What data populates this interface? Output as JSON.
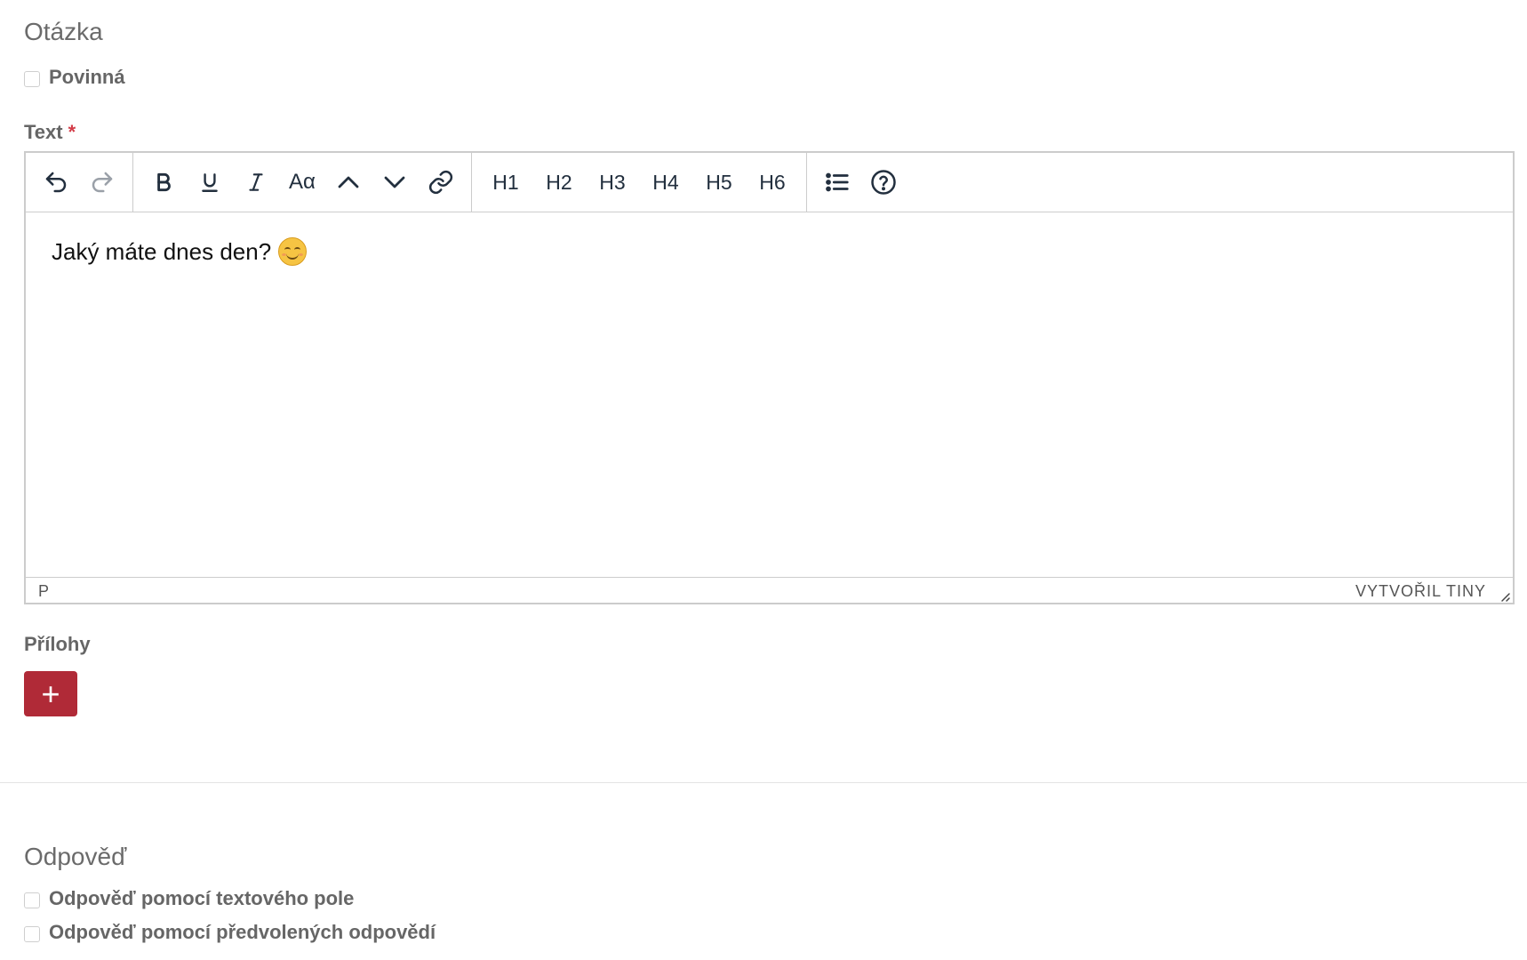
{
  "question": {
    "title": "Otázka",
    "required_label": "Povinná",
    "text_label": "Text",
    "required_marker": "*"
  },
  "editor": {
    "toolbar": {
      "undo": "undo-icon",
      "redo": "redo-icon",
      "bold": "bold-icon",
      "underline": "underline-icon",
      "italic": "italic-icon",
      "font_size_label": "Aα",
      "superscript": "chevron-up-icon",
      "subscript": "chevron-down-icon",
      "link": "link-icon",
      "headings": [
        "H1",
        "H2",
        "H3",
        "H4",
        "H5",
        "H6"
      ],
      "bullet_list": "bullet-list-icon",
      "help": "help-icon"
    },
    "content": "Jaký máte dnes den?",
    "emoji": "smiling-face-emoji",
    "status_path": "P",
    "status_brand": "VYTVOŘIL TINY"
  },
  "attachments": {
    "label": "Přílohy",
    "add_button_label": "+"
  },
  "answer": {
    "title": "Odpověď",
    "options": [
      "Odpověď pomocí textového pole",
      "Odpověď pomocí předvolených odpovědí"
    ]
  },
  "colors": {
    "accent": "#b02a37",
    "required": "#d33c48",
    "toolbar_icon": "#222f3e"
  }
}
